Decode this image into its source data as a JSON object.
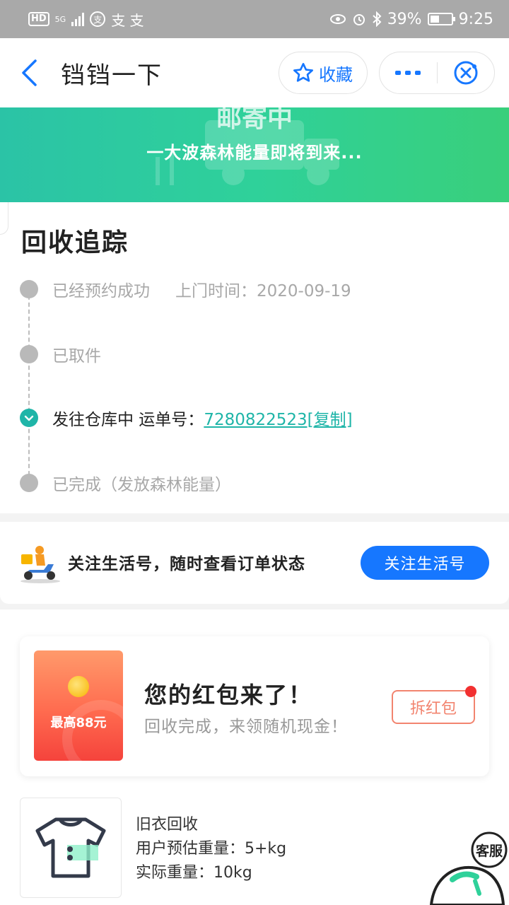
{
  "status_bar": {
    "network": "5G",
    "app_glyph": "支",
    "zhi_label": "支 支",
    "battery": "39%",
    "time": "9:25"
  },
  "nav": {
    "title": "铛铛一下",
    "favorite_label": "收藏"
  },
  "banner": {
    "headline": "邮寄中",
    "subtitle": "一大波森林能量即将到来..."
  },
  "tracking": {
    "title": "回收追踪",
    "steps": [
      {
        "label": "已经预约成功",
        "extra": "上门时间：2020-09-19"
      },
      {
        "label": "已取件"
      },
      {
        "label": "发往仓库中 运单号：",
        "link": "7280822523[复制]"
      },
      {
        "label": "已完成（发放森林能量）"
      }
    ]
  },
  "follow": {
    "text": "关注生活号，随时查看订单状态",
    "button": "关注生活号"
  },
  "red_packet": {
    "amount": "最高88元",
    "title": "您的红包来了！",
    "subtitle": "回收完成，来领随机现金！",
    "button": "拆红包"
  },
  "product": {
    "name": "旧衣回收",
    "estimated": "用户预估重量：5+kg",
    "actual": "实际重量：10kg"
  },
  "service": {
    "label": "客服"
  },
  "colors": {
    "accent_blue": "#1677ff",
    "teal": "#1fb5a8",
    "banner_green": "#2fd19a",
    "red": "#f5433c"
  }
}
